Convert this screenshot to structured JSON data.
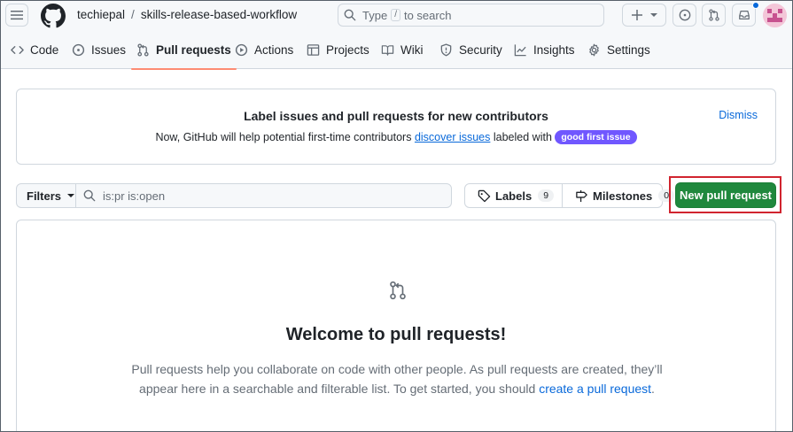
{
  "header": {
    "owner": "techiepal",
    "separator": "/",
    "repo": "skills-release-based-workflow",
    "search": {
      "prefix": "Type",
      "key": "/",
      "suffix": "to search"
    }
  },
  "nav": {
    "tabs": [
      {
        "label": "Code",
        "icon": "code-icon"
      },
      {
        "label": "Issues",
        "icon": "issue-icon"
      },
      {
        "label": "Pull requests",
        "icon": "pull-request-icon",
        "active": true
      },
      {
        "label": "Actions",
        "icon": "play-icon"
      },
      {
        "label": "Projects",
        "icon": "table-icon"
      },
      {
        "label": "Wiki",
        "icon": "book-icon"
      },
      {
        "label": "Security",
        "icon": "shield-icon"
      },
      {
        "label": "Insights",
        "icon": "graph-icon"
      },
      {
        "label": "Settings",
        "icon": "gear-icon"
      }
    ]
  },
  "banner": {
    "title": "Label issues and pull requests for new contributors",
    "text_before": "Now, GitHub will help potential first-time contributors",
    "link": "discover issues",
    "text_after": "labeled with",
    "label": "good first issue",
    "dismiss": "Dismiss"
  },
  "filters": {
    "button": "Filters",
    "query": "is:pr is:open",
    "labels": {
      "label": "Labels",
      "count": "9"
    },
    "milestones": {
      "label": "Milestones",
      "count": "0"
    },
    "new_pr": "New pull request"
  },
  "blankslate": {
    "title": "Welcome to pull requests!",
    "text": "Pull requests help you collaborate on code with other people. As pull requests are created, they’ll appear here in a searchable and filterable list. To get started, you should",
    "link": "create a pull request",
    "end": "."
  },
  "colors": {
    "accent": "#0969da",
    "primary_button": "#1f883d",
    "active_tab_underline": "#fd8c73",
    "label_good_first_issue": "#7057ff",
    "highlight_box": "#d1242f"
  }
}
